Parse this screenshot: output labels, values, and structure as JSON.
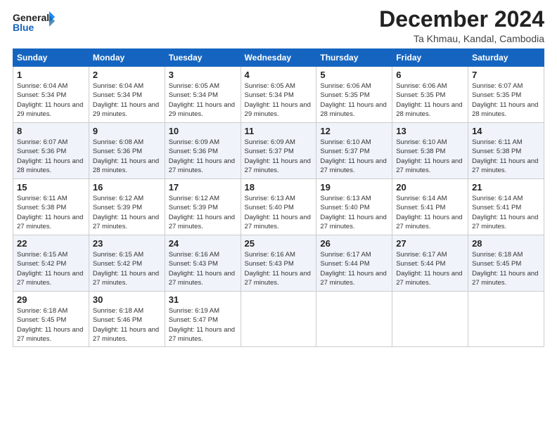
{
  "header": {
    "logo_general": "General",
    "logo_blue": "Blue",
    "month_title": "December 2024",
    "location": "Ta Khmau, Kandal, Cambodia"
  },
  "days_of_week": [
    "Sunday",
    "Monday",
    "Tuesday",
    "Wednesday",
    "Thursday",
    "Friday",
    "Saturday"
  ],
  "weeks": [
    [
      {
        "day": 1,
        "sunrise": "6:04 AM",
        "sunset": "5:34 PM",
        "daylight": "11 hours and 29 minutes."
      },
      {
        "day": 2,
        "sunrise": "6:04 AM",
        "sunset": "5:34 PM",
        "daylight": "11 hours and 29 minutes."
      },
      {
        "day": 3,
        "sunrise": "6:05 AM",
        "sunset": "5:34 PM",
        "daylight": "11 hours and 29 minutes."
      },
      {
        "day": 4,
        "sunrise": "6:05 AM",
        "sunset": "5:34 PM",
        "daylight": "11 hours and 29 minutes."
      },
      {
        "day": 5,
        "sunrise": "6:06 AM",
        "sunset": "5:35 PM",
        "daylight": "11 hours and 28 minutes."
      },
      {
        "day": 6,
        "sunrise": "6:06 AM",
        "sunset": "5:35 PM",
        "daylight": "11 hours and 28 minutes."
      },
      {
        "day": 7,
        "sunrise": "6:07 AM",
        "sunset": "5:35 PM",
        "daylight": "11 hours and 28 minutes."
      }
    ],
    [
      {
        "day": 8,
        "sunrise": "6:07 AM",
        "sunset": "5:36 PM",
        "daylight": "11 hours and 28 minutes."
      },
      {
        "day": 9,
        "sunrise": "6:08 AM",
        "sunset": "5:36 PM",
        "daylight": "11 hours and 28 minutes."
      },
      {
        "day": 10,
        "sunrise": "6:09 AM",
        "sunset": "5:36 PM",
        "daylight": "11 hours and 27 minutes."
      },
      {
        "day": 11,
        "sunrise": "6:09 AM",
        "sunset": "5:37 PM",
        "daylight": "11 hours and 27 minutes."
      },
      {
        "day": 12,
        "sunrise": "6:10 AM",
        "sunset": "5:37 PM",
        "daylight": "11 hours and 27 minutes."
      },
      {
        "day": 13,
        "sunrise": "6:10 AM",
        "sunset": "5:38 PM",
        "daylight": "11 hours and 27 minutes."
      },
      {
        "day": 14,
        "sunrise": "6:11 AM",
        "sunset": "5:38 PM",
        "daylight": "11 hours and 27 minutes."
      }
    ],
    [
      {
        "day": 15,
        "sunrise": "6:11 AM",
        "sunset": "5:38 PM",
        "daylight": "11 hours and 27 minutes."
      },
      {
        "day": 16,
        "sunrise": "6:12 AM",
        "sunset": "5:39 PM",
        "daylight": "11 hours and 27 minutes."
      },
      {
        "day": 17,
        "sunrise": "6:12 AM",
        "sunset": "5:39 PM",
        "daylight": "11 hours and 27 minutes."
      },
      {
        "day": 18,
        "sunrise": "6:13 AM",
        "sunset": "5:40 PM",
        "daylight": "11 hours and 27 minutes."
      },
      {
        "day": 19,
        "sunrise": "6:13 AM",
        "sunset": "5:40 PM",
        "daylight": "11 hours and 27 minutes."
      },
      {
        "day": 20,
        "sunrise": "6:14 AM",
        "sunset": "5:41 PM",
        "daylight": "11 hours and 27 minutes."
      },
      {
        "day": 21,
        "sunrise": "6:14 AM",
        "sunset": "5:41 PM",
        "daylight": "11 hours and 27 minutes."
      }
    ],
    [
      {
        "day": 22,
        "sunrise": "6:15 AM",
        "sunset": "5:42 PM",
        "daylight": "11 hours and 27 minutes."
      },
      {
        "day": 23,
        "sunrise": "6:15 AM",
        "sunset": "5:42 PM",
        "daylight": "11 hours and 27 minutes."
      },
      {
        "day": 24,
        "sunrise": "6:16 AM",
        "sunset": "5:43 PM",
        "daylight": "11 hours and 27 minutes."
      },
      {
        "day": 25,
        "sunrise": "6:16 AM",
        "sunset": "5:43 PM",
        "daylight": "11 hours and 27 minutes."
      },
      {
        "day": 26,
        "sunrise": "6:17 AM",
        "sunset": "5:44 PM",
        "daylight": "11 hours and 27 minutes."
      },
      {
        "day": 27,
        "sunrise": "6:17 AM",
        "sunset": "5:44 PM",
        "daylight": "11 hours and 27 minutes."
      },
      {
        "day": 28,
        "sunrise": "6:18 AM",
        "sunset": "5:45 PM",
        "daylight": "11 hours and 27 minutes."
      }
    ],
    [
      {
        "day": 29,
        "sunrise": "6:18 AM",
        "sunset": "5:45 PM",
        "daylight": "11 hours and 27 minutes."
      },
      {
        "day": 30,
        "sunrise": "6:18 AM",
        "sunset": "5:46 PM",
        "daylight": "11 hours and 27 minutes."
      },
      {
        "day": 31,
        "sunrise": "6:19 AM",
        "sunset": "5:47 PM",
        "daylight": "11 hours and 27 minutes."
      },
      null,
      null,
      null,
      null
    ]
  ]
}
